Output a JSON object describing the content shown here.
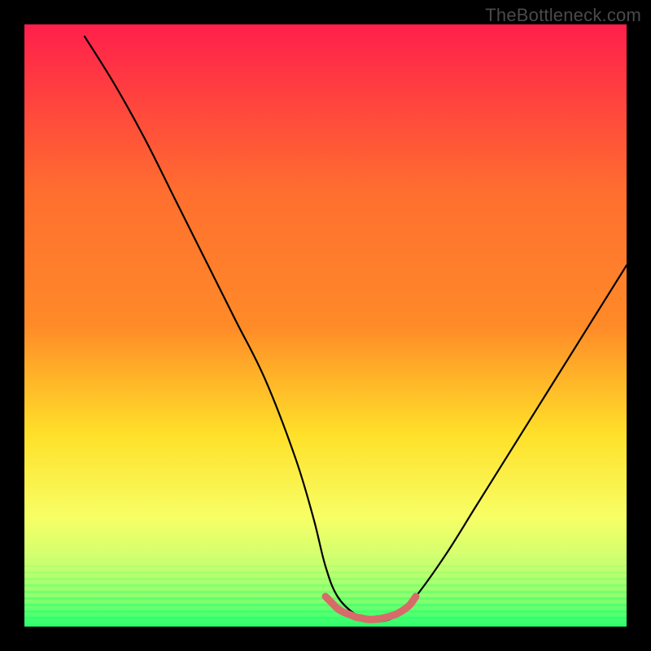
{
  "watermark": "TheBottleneck.com",
  "colors": {
    "frame_black": "#000000",
    "gradient_top": "#ff1f4b",
    "gradient_upper_mid": "#ff8a28",
    "gradient_mid": "#ffe029",
    "gradient_lower_mid": "#f7ff66",
    "gradient_low": "#c8ff70",
    "gradient_bottom": "#2bff6e",
    "curve_stroke": "#000000",
    "sweet_spot_stroke": "#d86a6a"
  },
  "chart_data": {
    "type": "line",
    "title": "",
    "xlabel": "",
    "ylabel": "",
    "xlim": [
      0,
      100
    ],
    "ylim": [
      0,
      100
    ],
    "series": [
      {
        "name": "bottleneck-curve",
        "x": [
          10,
          15,
          20,
          25,
          30,
          35,
          40,
          45,
          48,
          50,
          52,
          55,
          58,
          60,
          62,
          65,
          70,
          75,
          80,
          85,
          90,
          95,
          100
        ],
        "y": [
          98,
          90,
          81,
          71,
          61,
          51,
          41,
          28,
          18,
          10,
          5,
          2,
          1,
          1,
          2,
          5,
          12,
          20,
          28,
          36,
          44,
          52,
          60
        ]
      },
      {
        "name": "sweet-spot",
        "x": [
          50,
          51,
          52,
          53,
          54,
          55,
          56,
          57,
          58,
          59,
          60,
          61,
          62,
          63,
          64,
          65
        ],
        "y": [
          5,
          4,
          3,
          2.4,
          2,
          1.6,
          1.4,
          1.2,
          1.2,
          1.3,
          1.5,
          1.8,
          2.2,
          2.8,
          3.6,
          5
        ]
      }
    ],
    "notes": "No axes, ticks, or numeric labels are rendered in the image; values above are estimated from the curve shape relative to a 0–100 normalized plot area. Background is a vertical color gradient from red (top, high bottleneck) through orange/yellow to green (bottom, low bottleneck)."
  }
}
